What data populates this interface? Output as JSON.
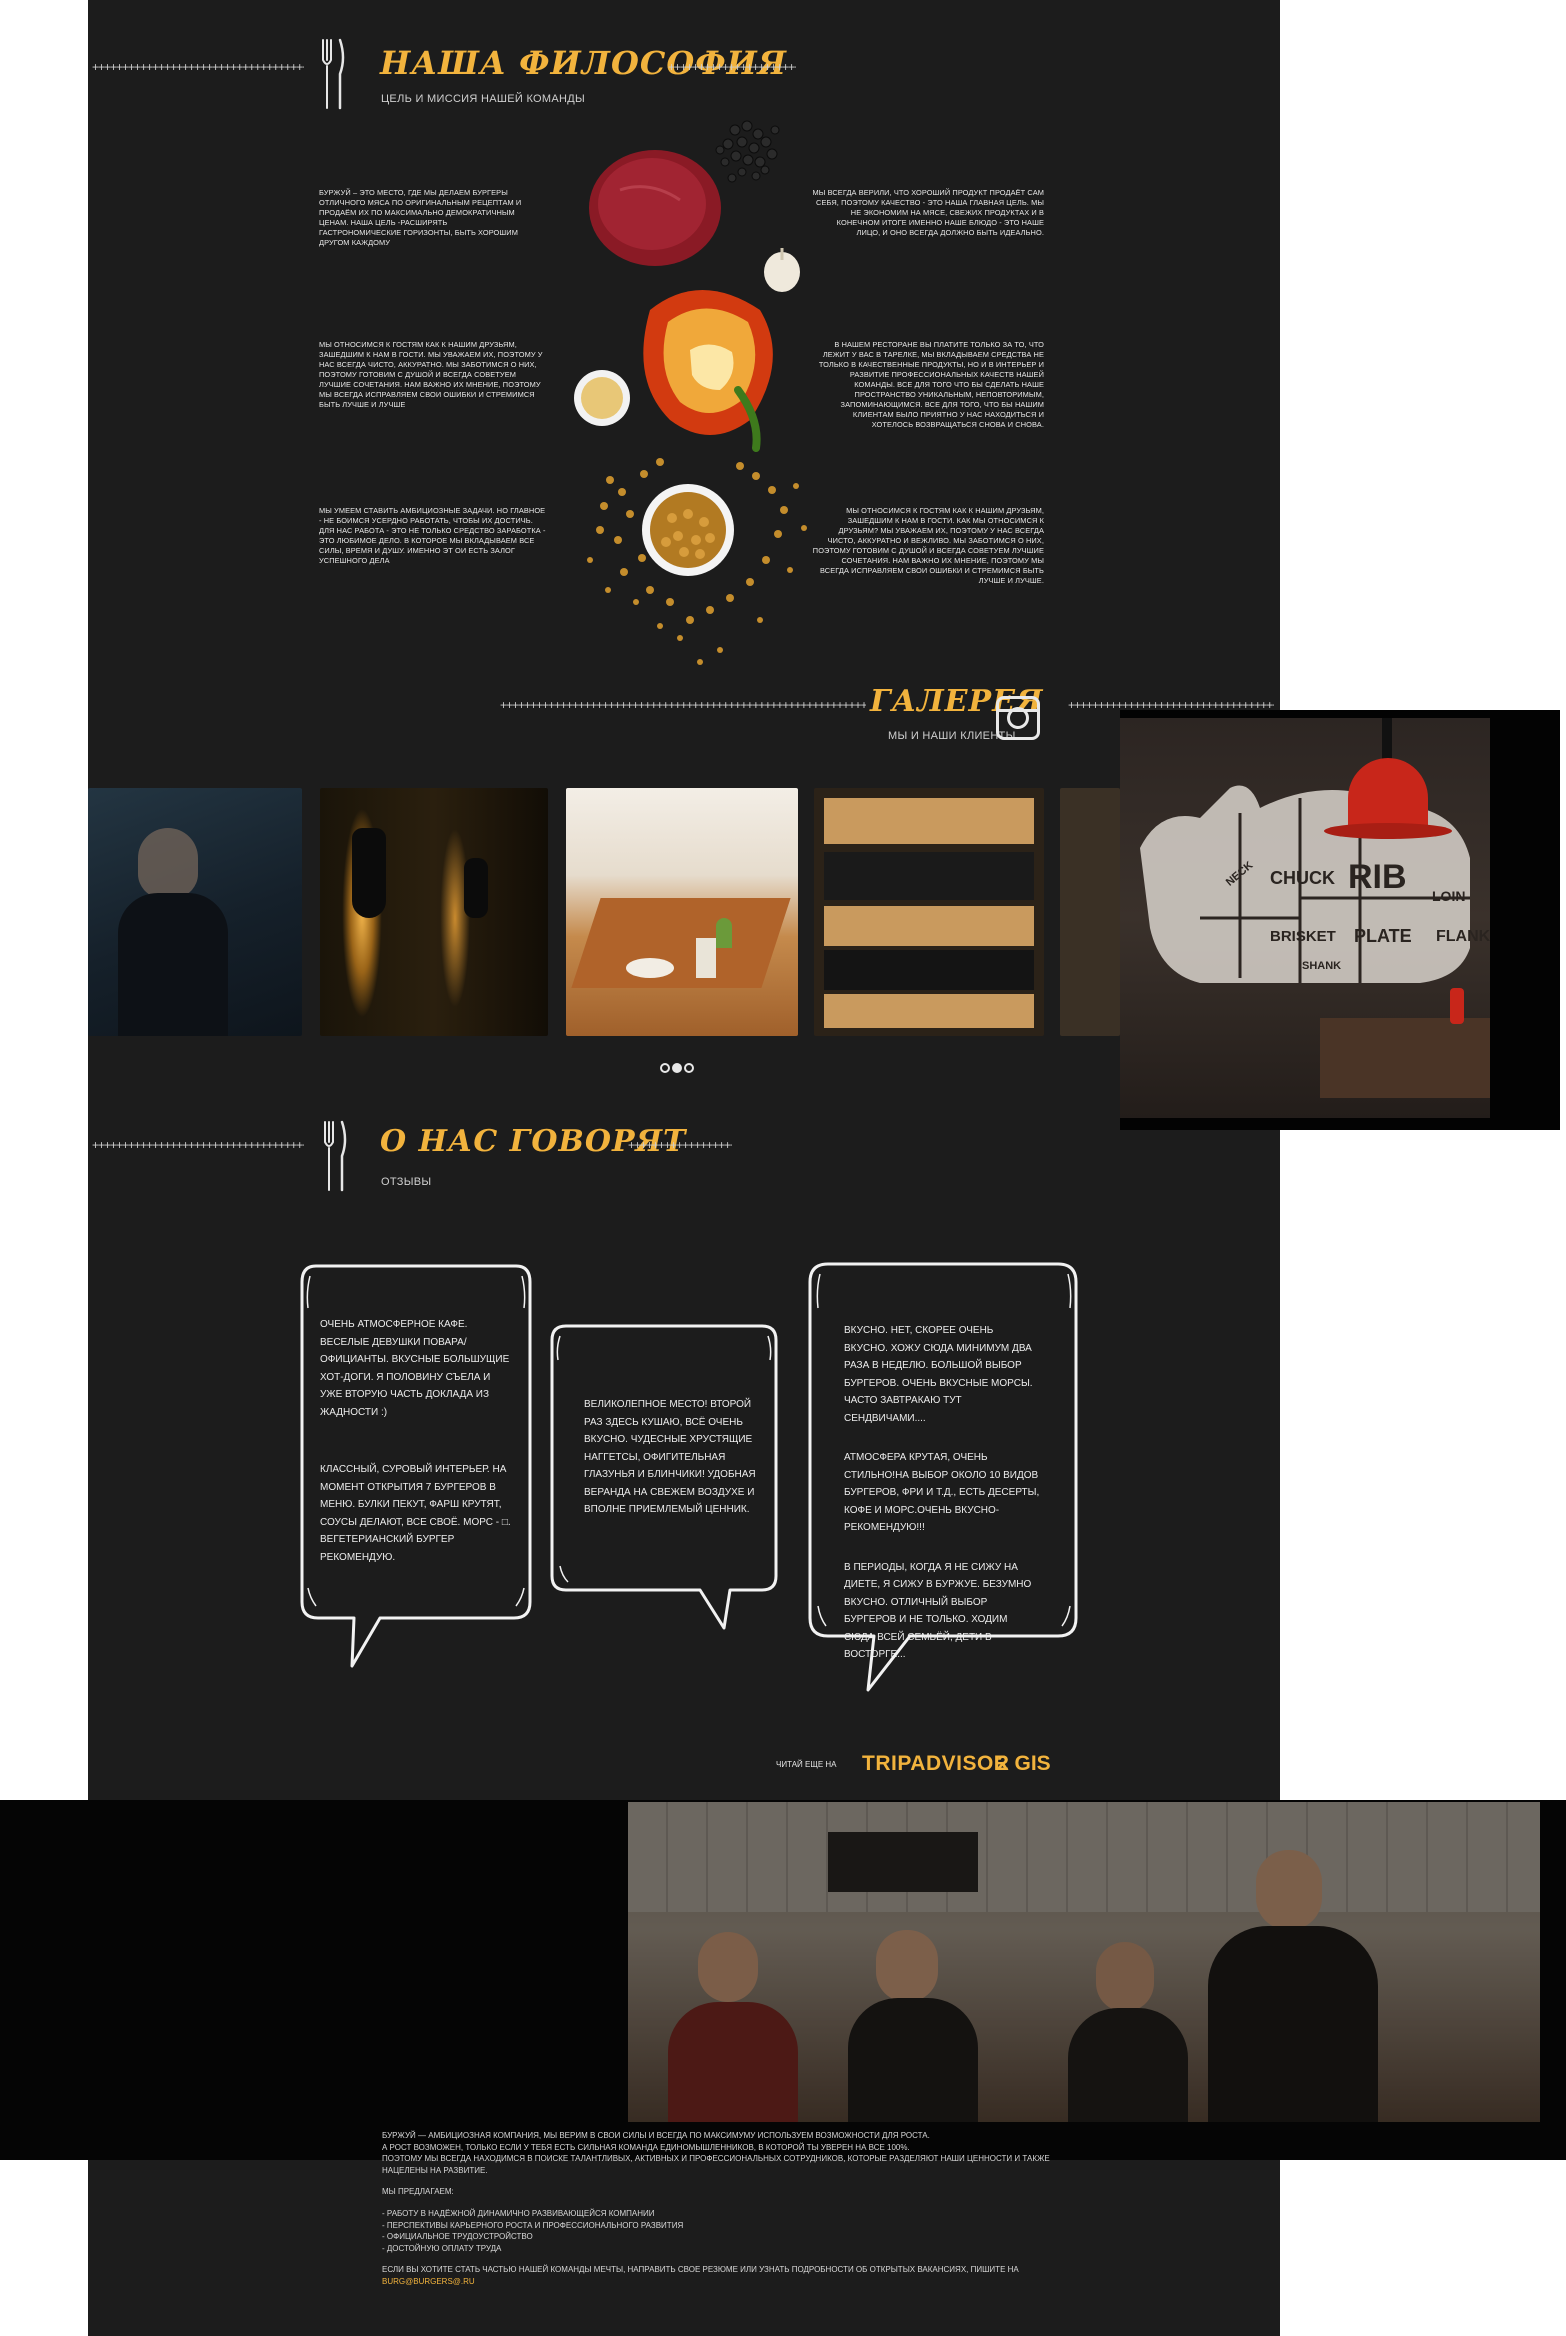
{
  "philosophy": {
    "title": "НАША ФИЛОСОФИЯ",
    "subtitle": "ЦЕЛЬ И МИССИЯ НАШЕЙ КОМАНДЫ",
    "paragraphs_left": [
      "БУРЖУЙ – ЭТО МЕСТО, ГДЕ МЫ ДЕЛАЕМ БУРГЕРЫ ОТЛИЧНОГО МЯСА ПО ОРИГИНАЛЬНЫМ РЕЦЕПТАМ И ПРОДАЁМ ИХ ПО МАКСИМАЛЬНО ДЕМОКРАТИЧНЫМ ЦЕНАМ. НАША ЦЕЛЬ -РАСШИРЯТЬ ГАСТРОНОМИЧЕСКИЕ ГОРИЗОНТЫ, БЫТЬ ХОРОШИМ ДРУГОМ КАЖДОМУ",
      "МЫ ОТНОСИМСЯ К ГОСТЯМ КАК К НАШИМ ДРУЗЬЯМ, ЗАШЕДШИМ К НАМ В ГОСТИ. МЫ УВАЖАЕМ ИХ, ПОЭТОМУ У НАС ВСЕГДА ЧИСТО, АККУРАТНО. МЫ ЗАБОТИМСЯ О НИХ, ПОЭТОМУ ГОТОВИМ С ДУШОЙ И ВСЕГДА СОВЕТУЕМ ЛУЧШИЕ СОЧЕТАНИЯ. НАМ ВАЖНО ИХ МНЕНИЕ, ПОЭТОМУ МЫ ВСЕГДА ИСПРАВЛЯЕМ СВОИ ОШИБКИ И СТРЕМИМСЯ БЫТЬ ЛУЧШЕ И ЛУЧШЕ",
      "МЫ УМЕЕМ СТАВИТЬ АМБИЦИОЗНЫЕ ЗАДАЧИ. НО ГЛАВНОЕ - НЕ БОИМСЯ УСЕРДНО РАБОТАТЬ, ЧТОБЫ ИХ ДОСТИЧЬ. ДЛЯ НАС РАБОТА - ЭТО НЕ ТОЛЬКО СРЕДСТВО ЗАРАБОТКА - ЭТО ЛЮБИМОЕ ДЕЛО. В КОТОРОЕ МЫ ВКЛАДЫВАЕМ ВСЕ СИЛЫ, ВРЕМЯ И ДУШУ. ИМЕННО ЭТ ОИ ЕСТЬ ЗАЛОГ УСПЕШНОГО ДЕЛА"
    ],
    "paragraphs_right": [
      "МЫ ВСЕГДА ВЕРИЛИ, ЧТО ХОРОШИЙ ПРОДУКТ ПРОДАЁТ САМ СЕБЯ, ПОЭТОМУ КАЧЕСТВО - ЭТО НАША ГЛАВНАЯ ЦЕЛЬ. МЫ НЕ ЭКОНОМИМ НА МЯСЕ, СВЕЖИХ ПРОДУКТАХ И В КОНЕЧНОМ ИТОГЕ ИМЕННО НАШЕ БЛЮДО - ЭТО НАШЕ ЛИЦО, И ОНО ВСЕГДА ДОЛЖНО БЫТЬ ИДЕАЛЬНО.",
      "В НАШЕМ РЕСТОРАНЕ ВЫ ПЛАТИТЕ ТОЛЬКО ЗА ТО, ЧТО ЛЕЖИТ У ВАС В ТАРЕЛКЕ, МЫ ВКЛАДЫВАЕМ СРЕДСТВА НЕ ТОЛЬКО В КАЧЕСТВЕННЫЕ ПРОДУКТЫ, НО И В ИНТЕРЬЕР И РАЗВИТИЕ ПРОФЕССИОНАЛЬНЫХ КАЧЕСТВ НАШЕЙ КОМАНДЫ. ВСЕ ДЛЯ ТОГО ЧТО БЫ СДЕЛАТЬ НАШЕ ПРОСТРАНСТВО УНИКАЛЬНЫМ, НЕПОВТОРИМЫМ, ЗАПОМИНАЮЩИМСЯ. ВСЕ ДЛЯ ТОГО, ЧТО БЫ НАШИМ КЛИЕНТАМ БЫЛО ПРИЯТНО У НАС НАХОДИТЬСЯ И ХОТЕЛОСЬ ВОЗВРАЩАТЬСЯ СНОВА И СНОВА.",
      "МЫ ОТНОСИМСЯ К ГОСТЯМ КАК К НАШИМ ДРУЗЬЯМ, ЗАШЕДШИМ К НАМ В ГОСТИ. КАК МЫ ОТНОСИМСЯ К ДРУЗЬЯМ? МЫ УВАЖАЕМ ИХ, ПОЭТОМУ У НАС ВСЕГДА ЧИСТО, АККУРАТНО И ВЕЖЛИВО. МЫ ЗАБОТИМСЯ О НИХ, ПОЭТОМУ ГОТОВИМ С ДУШОЙ И ВСЕГДА СОВЕТУЕМ ЛУЧШИЕ СОЧЕТАНИЯ. НАМ ВАЖНО ИХ МНЕНИЕ, ПОЭТОМУ МЫ ВСЕГДА ИСПРАВЛЯЕМ СВОИ ОШИБКИ И СТРЕМИМСЯ БЫТЬ ЛУЧШЕ И ЛУЧШЕ."
    ]
  },
  "gallery": {
    "title": "ГАЛЕРЕЯ",
    "subtitle": "МЫ И НАШИ КЛИЕНТЫ",
    "instagram_icon": "instagram-icon",
    "slider_dots": 3,
    "featured_labels": [
      "RIB",
      "CHUCK",
      "BRISKET",
      "PLATE",
      "FLANK",
      "LOIN",
      "NECK",
      "SHANK"
    ]
  },
  "reviews": {
    "title": "О НАС ГОВОРЯТ",
    "subtitle": "ОТЗЫВЫ",
    "bubble1": [
      "ОЧЕНЬ АТМОСФЕРНОЕ КАФЕ. ВЕСЕЛЫЕ ДЕВУШКИ ПОВАРА/ОФИЦИАНТЫ. ВКУСНЫЕ БОЛЬШУЩИЕ ХОТ-ДОГИ. Я ПОЛОВИНУ СЪЕЛА И УЖЕ ВТОРУЮ ЧАСТЬ ДОКЛАДА ИЗ ЖАДНОСТИ :)",
      "КЛАССНЫЙ, СУРОВЫЙ ИНТЕРЬЕР. НА МОМЕНТ ОТКРЫТИЯ 7 БУРГЕРОВ В МЕНЮ. БУЛКИ ПЕКУТ, ФАРШ КРУТЯТ, СОУСЫ ДЕЛАЮТ, ВСЕ СВОЁ. МОРС - □. ВЕГЕТЕРИАНСКИЙ БУРГЕР РЕКОМЕНДУЮ."
    ],
    "bubble2": [
      "ВЕЛИКОЛЕПНОЕ МЕСТО! ВТОРОЙ РАЗ ЗДЕСЬ КУШАЮ, ВСЁ ОЧЕНЬ ВКУСНО. ЧУДЕСНЫЕ ХРУСТЯЩИЕ НАГГЕТСЫ, ОФИГИТЕЛЬНАЯ ГЛАЗУНЬЯ И БЛИНЧИКИ! УДОБНАЯ ВЕРАНДА НА СВЕЖЕМ ВОЗДУХЕ И ВПОЛНЕ ПРИЕМЛЕМЫЙ ЦЕННИК."
    ],
    "bubble3": [
      "ВКУСНО. НЕТ, СКОРЕЕ ОЧЕНЬ ВКУСНО. ХОЖУ СЮДА МИНИМУМ ДВА РАЗА В НЕДЕЛЮ. БОЛЬШОЙ ВЫБОР БУРГЕРОВ. ОЧЕНЬ ВКУСНЫЕ МОРСЫ. ЧАСТО ЗАВТРАКАЮ ТУТ СЕНДВИЧАМИ....",
      "АТМОСФЕРА КРУТАЯ, ОЧЕНЬ СТИЛЬНО!НА ВЫБОР ОКОЛО 10 ВИДОВ БУРГЕРОВ, ФРИ И Т.Д., ЕСТЬ ДЕСЕРТЫ, КОФЕ И МОРС.ОЧЕНЬ ВКУСНО-РЕКОМЕНДУЮ!!!",
      "В ПЕРИОДЫ, КОГДА Я НЕ СИЖУ НА ДИЕТЕ, Я СИЖУ В БУРЖУЕ. БЕЗУМНО ВКУСНО. ОТЛИЧНЫЙ ВЫБОР БУРГЕРОВ И НЕ ТОЛЬКО. ХОДИМ СЮДА ВСЕЙ СЕМЬЁЙ, ДЕТИ В ВОСТОРГЕ..."
    ],
    "read_more": "ЧИТАЙ ЕЩЕ НА",
    "link_tripadvisor": "TRIPADVISOR",
    "link_2gis": "2 GIS"
  },
  "careers": {
    "intro": [
      "БУРЖУЙ — АМБИЦИОЗНАЯ КОМПАНИЯ, МЫ ВЕРИМ В СВОИ СИЛЫ И ВСЕГДА ПО МАКСИМУМУ ИСПОЛЬЗУЕМ ВОЗМОЖНОСТИ ДЛЯ РОСТА.",
      "А РОСТ ВОЗМОЖЕН, ТОЛЬКО ЕСЛИ У ТЕБЯ ЕСТЬ СИЛЬНАЯ КОМАНДА ЕДИНОМЫШЛЕННИКОВ, В КОТОРОЙ ТЫ УВЕРЕН НА ВСЕ 100%.",
      "ПОЭТОМУ МЫ ВСЕГДА НАХОДИМСЯ В ПОИСКЕ ТАЛАНТЛИВЫХ, АКТИВНЫХ И ПРОФЕССИОНАЛЬНЫХ СОТРУДНИКОВ, КОТОРЫЕ РАЗДЕЛЯЮТ НАШИ ЦЕННОСТИ И ТАКЖЕ НАЦЕЛЕНЫ НА РАЗВИТИЕ."
    ],
    "offer_title": "МЫ ПРЕДЛАГАЕМ:",
    "offers": [
      "- РАБОТУ В НАДЁЖНОЙ ДИНАМИЧНО РАЗВИВАЮЩЕЙСЯ КОМПАНИИ",
      "- ПЕРСПЕКТИВЫ КАРЬЕРНОГО РОСТА И ПРОФЕССИОНАЛЬНОГО РАЗВИТИЯ",
      "- ОФИЦИАЛЬНОЕ ТРУДОУСТРОЙСТВО",
      "- ДОСТОЙНУЮ ОПЛАТУ ТРУДА"
    ],
    "cta": "ЕСЛИ ВЫ ХОТИТЕ СТАТЬ ЧАСТЬЮ НАШЕЙ КОМАНДЫ МЕЧТЫ, НАПРАВИТЬ СВОЕ РЕЗЮМЕ ИЛИ УЗНАТЬ ПОДРОБНОСТИ ОБ ОТКРЫТЫХ ВАКАНСИЯХ, ПИШИТЕ НА",
    "email": "BURG@BURGERS@.RU"
  },
  "colors": {
    "page_bg": "#1c1c1c",
    "accent": "#f2b33d",
    "text": "#e8e8e8",
    "lamp_red": "#c8261a"
  }
}
